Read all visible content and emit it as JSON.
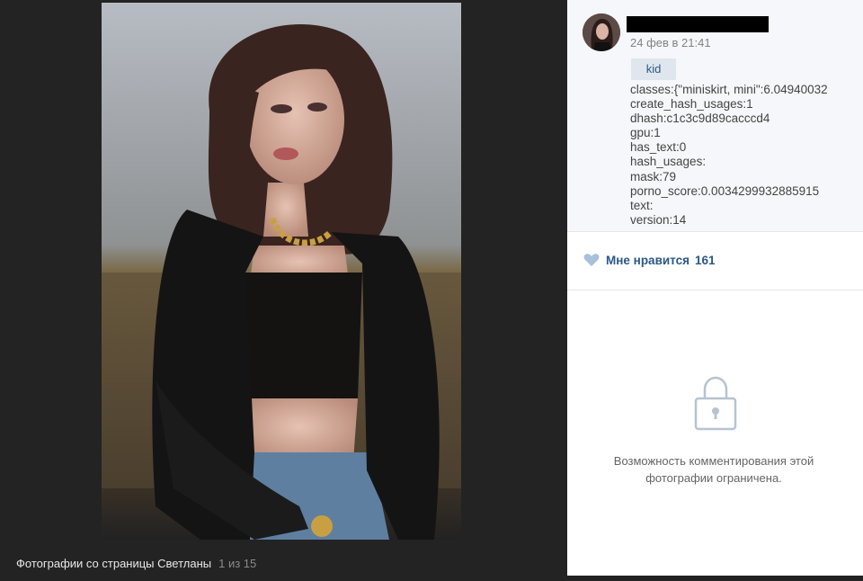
{
  "caption": {
    "title": "Фотографии со страницы Светланы",
    "counter": "1 из 15"
  },
  "post": {
    "date": "24 фев в 21:41",
    "tag": "kid",
    "meta_lines": [
      "classes:{\"miniskirt, mini\":6.04940032",
      "create_hash_usages:1",
      "dhash:c1c3c9d89cacccd4",
      "gpu:1",
      "has_text:0",
      "hash_usages:",
      "mask:79",
      "porno_score:0.0034299932885915",
      "text:",
      "version:14"
    ]
  },
  "likes": {
    "label": "Мне нравится",
    "count": "161"
  },
  "comments": {
    "restricted_line1": "Возможность комментирования этой",
    "restricted_line2": "фотографии ограничена."
  },
  "icons": {
    "like": "heart-icon",
    "comments_locked": "lock-icon"
  },
  "colors": {
    "viewer_bg": "#232323",
    "panel_bg": "#ffffff",
    "link_blue": "#2a5885",
    "like_heart": "#a8c0da"
  }
}
